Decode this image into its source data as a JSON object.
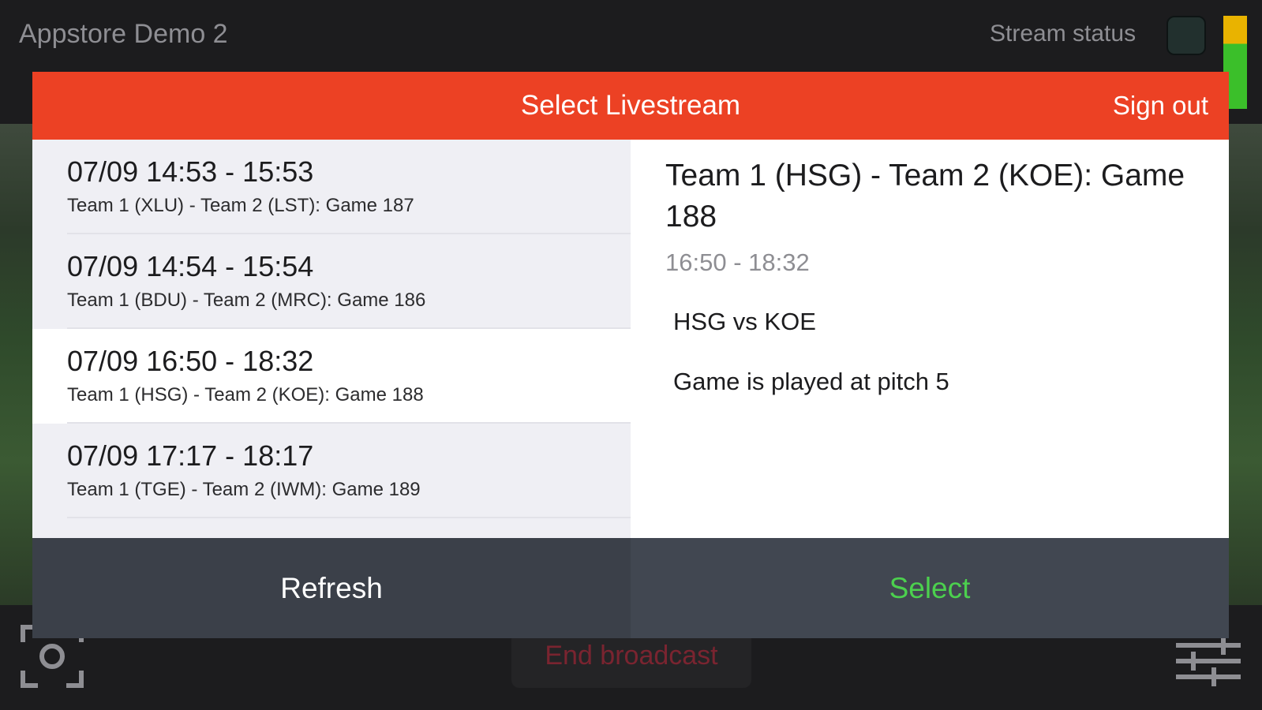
{
  "app": {
    "title": "Appstore Demo 2",
    "stream_status_label": "Stream status"
  },
  "modal": {
    "title": "Select Livestream",
    "sign_out_label": "Sign out",
    "items": [
      {
        "time": "07/09 14:53 - 15:53",
        "title": "Team 1 (XLU) - Team 2 (LST): Game 187"
      },
      {
        "time": "07/09 14:54 - 15:54",
        "title": "Team 1 (BDU) - Team 2 (MRC): Game 186"
      },
      {
        "time": "07/09 16:50 - 18:32",
        "title": "Team 1 (HSG) - Team 2 (KOE): Game 188"
      },
      {
        "time": "07/09 17:17 - 18:17",
        "title": "Team 1 (TGE) - Team 2 (IWM): Game 189"
      }
    ],
    "selected_index": 2,
    "detail": {
      "title": "Team 1 (HSG) - Team 2 (KOE): Game 188",
      "time": "16:50 - 18:32",
      "description": "HSG vs KOE",
      "location": "Game is played at pitch 5"
    },
    "refresh_label": "Refresh",
    "select_label": "Select"
  },
  "controls": {
    "end_broadcast_label": "End broadcast",
    "camera_switch_icon": "camera-switch-icon",
    "settings_icon": "sliders-icon"
  },
  "colors": {
    "header": "#ec4124",
    "select_green": "#4cd04e",
    "footer": "#3e434c",
    "end_broadcast": "#7a2430"
  }
}
